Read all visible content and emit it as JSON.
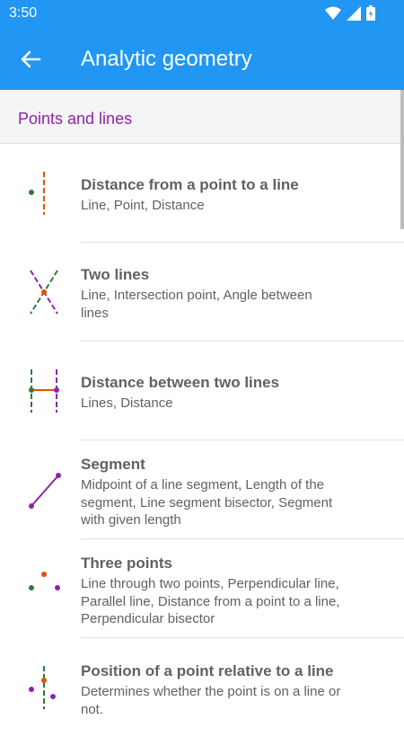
{
  "status_bar": {
    "time": "3:50"
  },
  "app_bar": {
    "title": "Analytic geometry",
    "back_icon": "arrow-back-icon"
  },
  "section": {
    "title": "Points and lines"
  },
  "colors": {
    "primary": "#2196f3",
    "accent": "#8e24aa",
    "orange": "#e65100",
    "green": "#2e7d32"
  },
  "items": [
    {
      "title": "Distance from a point to a line",
      "subtitle": "Line, Point, Distance",
      "icon": "point-line-distance-icon"
    },
    {
      "title": "Two lines",
      "subtitle": "Line, Intersection point, Angle between lines",
      "icon": "two-lines-icon"
    },
    {
      "title": "Distance between two lines",
      "subtitle": "Lines, Distance",
      "icon": "parallel-lines-distance-icon"
    },
    {
      "title": "Segment",
      "subtitle": "Midpoint of a line segment, Length of the segment, Line segment bisector, Segment with given length",
      "icon": "segment-icon"
    },
    {
      "title": "Three points",
      "subtitle": "Line through two points, Perpendicular line, Parallel line, Distance from a point to a line, Perpendicular bisector",
      "icon": "three-points-icon"
    },
    {
      "title": "Position of a point relative to a line",
      "subtitle": "Determines whether the point is on a line or not.",
      "icon": "point-position-icon"
    }
  ]
}
